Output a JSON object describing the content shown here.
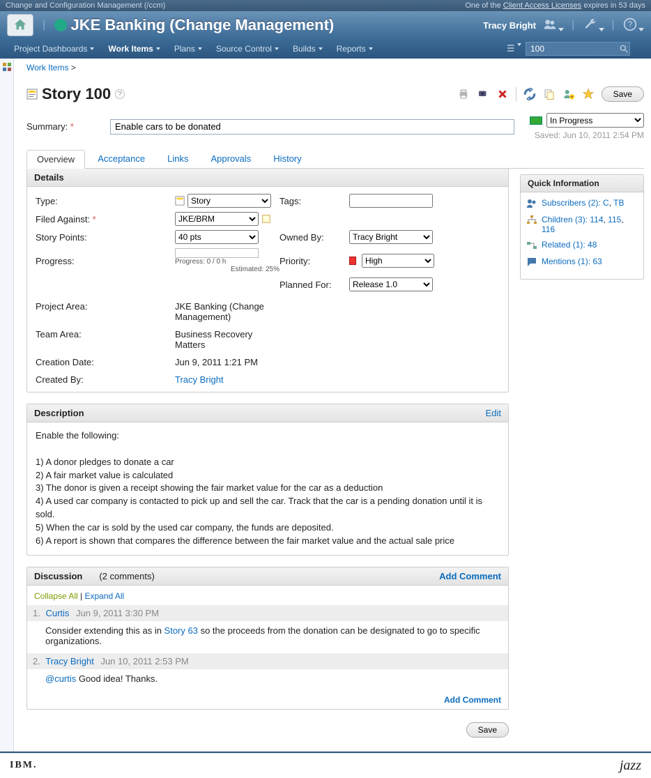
{
  "topBar": {
    "leftText": "Change and Configuration Management (/ccm)",
    "rightPrefix": "One of the ",
    "rightLink": "Client Access Licenses",
    "rightSuffix": " expires in 53 days"
  },
  "titleBar": {
    "projectTitle": "JKE Banking (Change Management)",
    "userName": "Tracy Bright"
  },
  "menuBar": {
    "items": [
      {
        "label": "Project Dashboards",
        "active": false
      },
      {
        "label": "Work Items",
        "active": true
      },
      {
        "label": "Plans",
        "active": false
      },
      {
        "label": "Source Control",
        "active": false
      },
      {
        "label": "Builds",
        "active": false
      },
      {
        "label": "Reports",
        "active": false
      }
    ],
    "searchValue": "100"
  },
  "breadcrumb": {
    "label": "Work Items",
    "arrow": ">"
  },
  "workItem": {
    "heading": "Story 100",
    "summaryLabel": "Summary:",
    "summaryValue": "Enable cars to be donated",
    "status": "In Progress",
    "savedText": "Saved: Jun 10, 2011 2:54 PM",
    "saveLabel": "Save"
  },
  "tabs": [
    {
      "label": "Overview",
      "active": true
    },
    {
      "label": "Acceptance",
      "active": false
    },
    {
      "label": "Links",
      "active": false
    },
    {
      "label": "Approvals",
      "active": false
    },
    {
      "label": "History",
      "active": false
    }
  ],
  "details": {
    "header": "Details",
    "typeLabel": "Type:",
    "typeValue": "Story",
    "filedAgainstLabel": "Filed Against:",
    "filedAgainstValue": "JKE/BRM",
    "storyPointsLabel": "Story Points:",
    "storyPointsValue": "40 pts",
    "progressLabel": "Progress:",
    "progressText": "Progress:  0 / 0 h",
    "progressEst": "Estimated: 25%",
    "tagsLabel": "Tags:",
    "tagsValue": "",
    "ownedByLabel": "Owned By:",
    "ownedByValue": "Tracy Bright",
    "priorityLabel": "Priority:",
    "priorityValue": "High",
    "plannedForLabel": "Planned For:",
    "plannedForValue": "Release 1.0",
    "projectAreaLabel": "Project Area:",
    "projectAreaValue": "JKE Banking (Change Management)",
    "teamAreaLabel": "Team Area:",
    "teamAreaValue": "Business Recovery Matters",
    "creationDateLabel": "Creation Date:",
    "creationDateValue": "Jun 9, 2011 1:21 PM",
    "createdByLabel": "Created By:",
    "createdByValue": "Tracy Bright"
  },
  "description": {
    "header": "Description",
    "editLabel": "Edit",
    "text": "Enable the following:\n\n1) A donor pledges to donate a car\n2) A fair market value is calculated\n3) The donor is given a receipt showing the fair market value for the car as a deduction\n4) A used car company is contacted to pick up and sell the car. Track that the car is a pending donation until it is sold.\n5) When the car is sold by the used car company, the funds are deposited.\n6) A report is shown that compares the difference between the fair market value and the actual sale price"
  },
  "discussion": {
    "header": "Discussion",
    "countText": "(2 comments)",
    "addCommentLabel": "Add Comment",
    "collapseLabel": "Collapse All",
    "expandLabel": "Expand All",
    "sep": " | ",
    "comments": [
      {
        "num": "1.",
        "author": "Curtis",
        "date": "Jun 9, 2011 3:30 PM",
        "prefix": "Consider extending this as in ",
        "linkText": "Story 63",
        "suffix": " so the proceeds from the donation can be designated to go to specific organizations."
      },
      {
        "num": "2.",
        "author": "Tracy Bright",
        "date": "Jun 10, 2011 2:53 PM",
        "mention": "@curtis",
        "body": " Good idea! Thanks."
      }
    ]
  },
  "quickInfo": {
    "header": "Quick Information",
    "subscribers": {
      "label": "Subscribers (2): ",
      "v1": "C",
      "v2": "TB"
    },
    "children": {
      "label": "Children (3): ",
      "v1": "114",
      "v2": "115",
      "v3": "116"
    },
    "related": {
      "label": "Related (1): ",
      "v1": "48"
    },
    "mentions": {
      "label": "Mentions (1): ",
      "v1": "63"
    }
  },
  "footer": {
    "ibm": "IBM.",
    "jazz": "jazz"
  }
}
